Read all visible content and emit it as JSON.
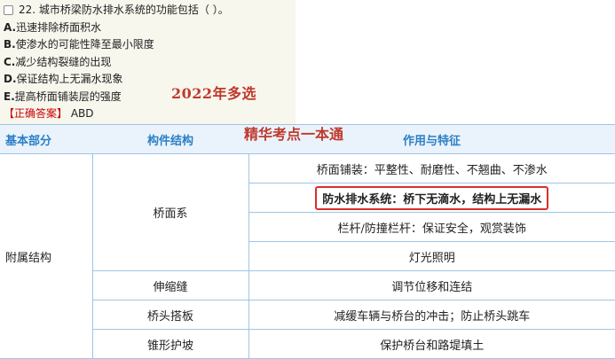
{
  "question": {
    "number_text": "22. 城市桥梁防水排水系统的功能包括（ ）。",
    "options": [
      {
        "letter": "A.",
        "text": "迅速排除桥面积水"
      },
      {
        "letter": "B.",
        "text": "使渗水的可能性降至最小限度"
      },
      {
        "letter": "C.",
        "text": "减少结构裂缝的出现"
      },
      {
        "letter": "D.",
        "text": "保证结构上无漏水现象"
      },
      {
        "letter": "E.",
        "text": "提高桥面铺装层的强度"
      }
    ],
    "answer_label": "【正确答案】",
    "answer_value": "ABD",
    "year_tag": "2022年多选"
  },
  "overlay_title": "精华考点一本通",
  "table": {
    "headers": [
      "基本部分",
      "构件结构",
      "作用与特征"
    ],
    "base_part": "附属结构",
    "deck_system": "桥面系",
    "deck_rows": [
      "桥面铺装：平整性、耐磨性、不翘曲、不渗水",
      "防水排水系统：桥下无滴水，结构上无漏水",
      "栏杆/防撞栏杆：保证安全，观赏装饰",
      "灯光照明"
    ],
    "other_rows": [
      {
        "component": "伸缩缝",
        "feature": "调节位移和连结"
      },
      {
        "component": "桥头搭板",
        "feature": "减缓车辆与桥台的冲击；防止桥头跳车"
      },
      {
        "component": "锥形护坡",
        "feature": "保护桥台和路堤填土"
      }
    ]
  },
  "colors": {
    "header_blue": "#2b7fc7",
    "red": "#c0392b",
    "border": "#9fc4e6"
  }
}
